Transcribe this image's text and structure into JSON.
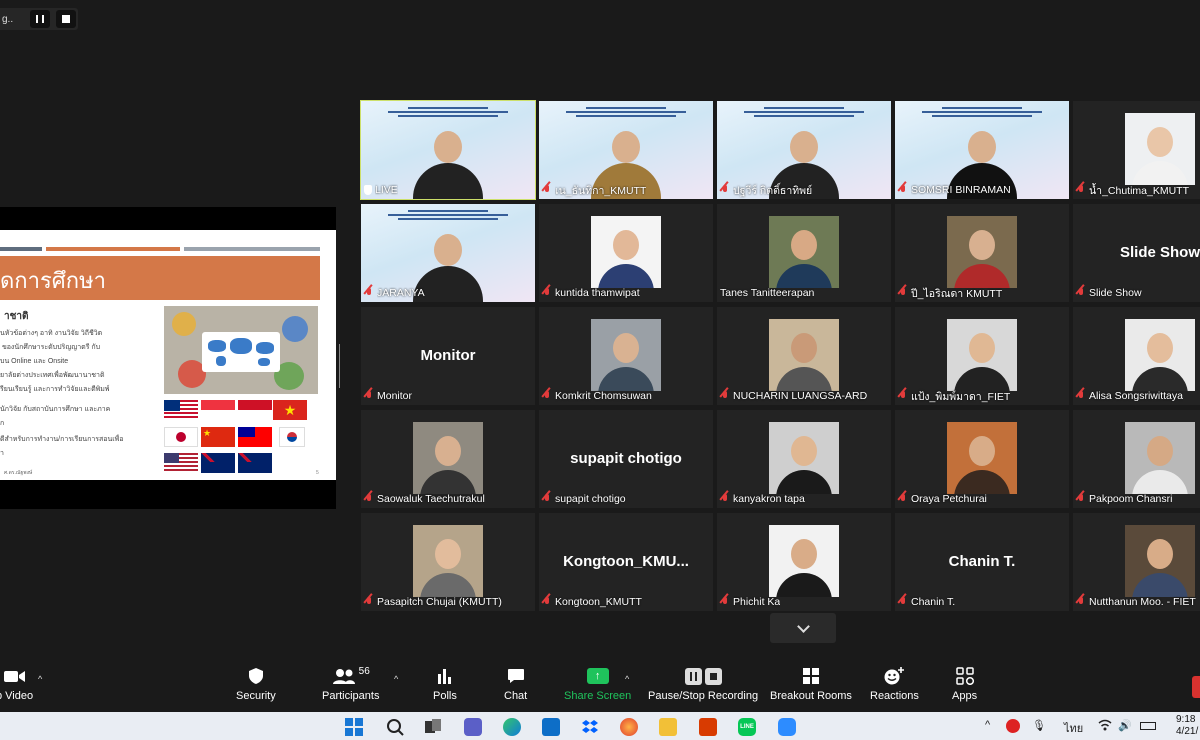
{
  "recording": {
    "label": "g.."
  },
  "slide": {
    "title": "ัดการศึกษา",
    "subheading": "าชาติ",
    "lines": [
      "นหัวข้อต่างๆ อาทิ งานวิจัย วิถีชีวิต",
      "ั ของนักศึกษาระดับปริญญาตรี กับ",
      "บน Online และ Onsite",
      "ยาลัยต่างประเทศเพื่อพัฒนานาชาติ",
      "รียนเรียนรู้ และการทำวิจัยและตีพิมพ์",
      "นักวิจัย กับสถาบันการศึกษา และภาค",
      "ก",
      "ดีสำหรับการทำงาน/การเรียนการสอนเพื่อ",
      "า"
    ],
    "footer": "ศ.ดร.ณัฐพงษ์",
    "page": "5"
  },
  "colors": {
    "accent_green": "#1fc35c",
    "active_speaker": "#cde06a",
    "muted_red": "#e23b3b",
    "slide_orange": "#d47848"
  },
  "participants": [
    {
      "name": "LIVE",
      "kind": "stream",
      "muted": false,
      "active": true,
      "pin": true,
      "shirt": "#222"
    },
    {
      "name": "เน_ธันทิกา_KMUTT",
      "kind": "stream",
      "muted": true,
      "shirt": "#a07a3a"
    },
    {
      "name": "ปฐวีร์ กิตติ์ธาทิพย์",
      "kind": "stream",
      "muted": true,
      "shirt": "#222"
    },
    {
      "name": "SOMSRI BINRAMAN",
      "kind": "stream",
      "muted": true,
      "shirt": "#111"
    },
    {
      "name": "น้ำ_Chutima_KMUTT",
      "kind": "photo",
      "muted": true,
      "bg": "#eef0f2",
      "skin": "#e9c6a8",
      "shirt": "#f2f2f2"
    },
    {
      "name": "JARANYA",
      "kind": "stream",
      "muted": true,
      "shirt": "#222"
    },
    {
      "name": "kuntida thamwipat",
      "kind": "photo",
      "muted": true,
      "bg": "#f4f4f4",
      "skin": "#e2b898",
      "shirt": "#2c3f73"
    },
    {
      "name": "Tanes Tanitteerapan",
      "kind": "photo",
      "muted": false,
      "bg": "#6e7a55",
      "skin": "#d8a985",
      "shirt": "#1f3a5a"
    },
    {
      "name": "ปี_ไอริณดา KMUTT",
      "kind": "photo",
      "muted": true,
      "bg": "#7b6a4e",
      "skin": "#d8b090",
      "shirt": "#b02a2a"
    },
    {
      "name": "Slide Show",
      "kind": "name",
      "muted": true,
      "label": "Slide Show"
    },
    {
      "name": "Monitor",
      "kind": "name",
      "muted": true,
      "label": "Monitor"
    },
    {
      "name": "Komkrit Chomsuwan",
      "kind": "photo",
      "muted": true,
      "bg": "#9aa0a6",
      "skin": "#d9b292",
      "shirt": "#3a4a5a"
    },
    {
      "name": "NUCHARIN LUANGSA-ARD",
      "kind": "photo",
      "muted": true,
      "bg": "#c9b79a",
      "skin": "#c99a78",
      "shirt": "#555"
    },
    {
      "name": "แป้ง_พิมพ์มาดา_FIET",
      "kind": "photo",
      "muted": true,
      "bg": "#d8d8d8",
      "skin": "#e0b894",
      "shirt": "#222"
    },
    {
      "name": "Alisa Songsriwittaya",
      "kind": "photo",
      "muted": true,
      "bg": "#eaeaea",
      "skin": "#e4bd9c",
      "shirt": "#2a2a2a"
    },
    {
      "name": "Saowaluk Taechutrakul",
      "kind": "photo",
      "muted": true,
      "bg": "#8f8a80",
      "skin": "#d8b090",
      "shirt": "#333"
    },
    {
      "name": "supapit chotigo",
      "kind": "name",
      "muted": true,
      "label": "supapit chotigo"
    },
    {
      "name": "kanyakron tapa",
      "kind": "photo",
      "muted": true,
      "bg": "#cfcfcf",
      "skin": "#e0b792",
      "shirt": "#1a1a1a"
    },
    {
      "name": "Oraya Petchurai",
      "kind": "photo",
      "muted": true,
      "bg": "#c2703a",
      "skin": "#d8ac88",
      "shirt": "#3b2a20"
    },
    {
      "name": "Pakpoom Chansri",
      "kind": "photo",
      "muted": true,
      "bg": "#b9b9b9",
      "skin": "#d5a985",
      "shirt": "#eaeaea"
    },
    {
      "name": "Pasapitch Chujai (KMUTT)",
      "kind": "photo",
      "muted": true,
      "bg": "#b5a48a",
      "skin": "#e2bc9c",
      "shirt": "#6a6a6a"
    },
    {
      "name": "Kongtoon_KMUTT",
      "kind": "name",
      "muted": true,
      "label": "Kongtoon_KMU..."
    },
    {
      "name": "Phichit Ka",
      "kind": "photo",
      "muted": true,
      "bg": "#f2f2f2",
      "skin": "#d9ac88",
      "shirt": "#1a1a1a"
    },
    {
      "name": "Chanin T.",
      "kind": "name",
      "muted": true,
      "label": "Chanin T."
    },
    {
      "name": "Nutthanun Moo. - FIET",
      "kind": "photo",
      "muted": true,
      "bg": "#5a4a3a",
      "skin": "#d8ac88",
      "shirt": "#3a4a6a"
    }
  ],
  "toolbar": {
    "video": "p Video",
    "security": "Security",
    "participants": "Participants",
    "participant_count": "56",
    "polls": "Polls",
    "chat": "Chat",
    "share": "Share Screen",
    "recording": "Pause/Stop Recording",
    "breakout": "Breakout Rooms",
    "reactions": "Reactions",
    "apps": "Apps"
  },
  "taskbar": {
    "language": "ไทย",
    "time": "9:18",
    "date": "4/21/"
  }
}
